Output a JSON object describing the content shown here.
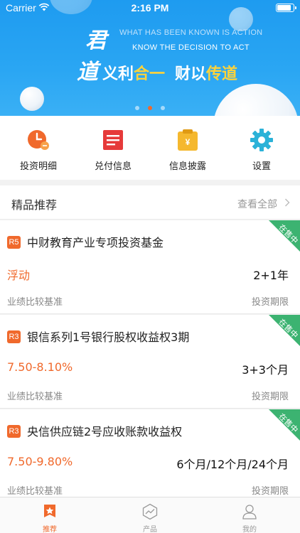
{
  "status_bar": {
    "carrier": "Carrier",
    "time": "2:16 PM",
    "battery_level": 0.95
  },
  "banner": {
    "calligraphy": [
      "君",
      "道"
    ],
    "motto_en_line1": "WHAT HAS BEEN KNOWN IS ACTION",
    "motto_en_line2": "KNOW THE DECISION TO ACT",
    "slogan_part1": "义利",
    "slogan_part2": "合一",
    "slogan_part3": "财以",
    "slogan_part4": "传道",
    "page_index": 2,
    "page_count": 3
  },
  "quick_menu": [
    {
      "label": "投资明细",
      "icon": "investment-detail-icon"
    },
    {
      "label": "兑付信息",
      "icon": "payout-info-icon"
    },
    {
      "label": "信息披露",
      "icon": "disclosure-icon"
    },
    {
      "label": "设置",
      "icon": "settings-gear-icon"
    }
  ],
  "section": {
    "title": "精品推荐",
    "view_all": "查看全部"
  },
  "products": [
    {
      "risk": "R5",
      "name": "中财教育产业专项投资基金",
      "rate": "浮动",
      "rate_label": "业绩比较基准",
      "term": "2+1年",
      "term_label": "投资期限",
      "status": "在售中"
    },
    {
      "risk": "R3",
      "name": "银信系列1号银行股权收益权3期",
      "rate": "7.50-8.10%",
      "rate_label": "业绩比较基准",
      "term": "3+3个月",
      "term_label": "投资期限",
      "status": "在售中"
    },
    {
      "risk": "R3",
      "name": "央信供应链2号应收账款收益权",
      "rate": "7.50-9.80%",
      "rate_label": "业绩比较基准",
      "term": "6个月/12个月/24个月",
      "term_label": "投资期限",
      "status": "在售中"
    }
  ],
  "tabbar": [
    {
      "label": "推荐",
      "icon": "star-badge-icon",
      "active": true
    },
    {
      "label": "产品",
      "icon": "trend-chart-icon",
      "active": false
    },
    {
      "label": "我的",
      "icon": "user-profile-icon",
      "active": false
    }
  ],
  "colors": {
    "accent": "#f0692c",
    "banner_blue": "#1e9bf0",
    "slogan_yellow": "#ffd33a",
    "on_sale_green": "#3cb371"
  }
}
